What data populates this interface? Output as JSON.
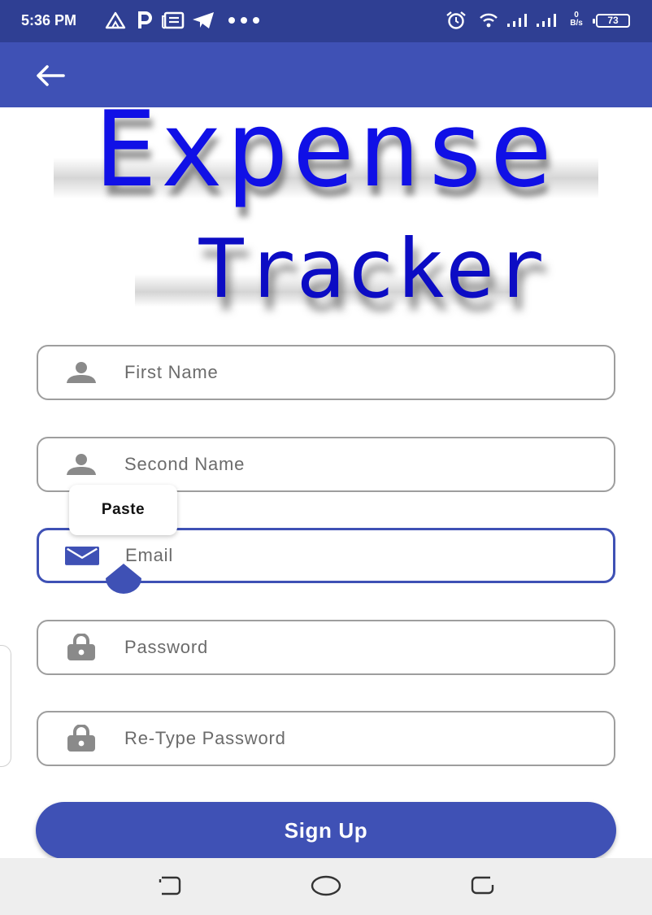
{
  "status_bar": {
    "time": "5:36 PM",
    "speed_value": "0",
    "speed_unit": "B/s",
    "battery": "73",
    "icons": [
      "alert-triangle-icon",
      "parking-icon",
      "news-icon",
      "telegram-icon",
      "more-dots-icon",
      "alarm-icon",
      "wifi-icon",
      "signal-icon",
      "signal-icon",
      "battery-icon"
    ]
  },
  "app_bar": {
    "back_icon": "arrow-left-icon"
  },
  "logo": {
    "line1": "Expense",
    "line2": "Tracker",
    "color": "#1010e6"
  },
  "form": {
    "first_name": {
      "placeholder": "First Name",
      "icon": "person-icon"
    },
    "second_name": {
      "placeholder": "Second Name",
      "icon": "person-icon"
    },
    "email": {
      "placeholder": "Email",
      "icon": "envelope-icon"
    },
    "password": {
      "placeholder": "Password",
      "icon": "lock-icon"
    },
    "retype_password": {
      "placeholder": "Re-Type Password",
      "icon": "lock-icon"
    },
    "submit_label": "Sign Up"
  },
  "context_menu": {
    "paste_label": "Paste"
  },
  "colors": {
    "primary": "#3f51b5",
    "status_bar": "#2f3f93",
    "field_border": "#9e9e9e",
    "nav_bar": "#eeeeee"
  },
  "nav_bar": {
    "icons": [
      "recents-icon",
      "home-icon",
      "back-icon"
    ]
  }
}
